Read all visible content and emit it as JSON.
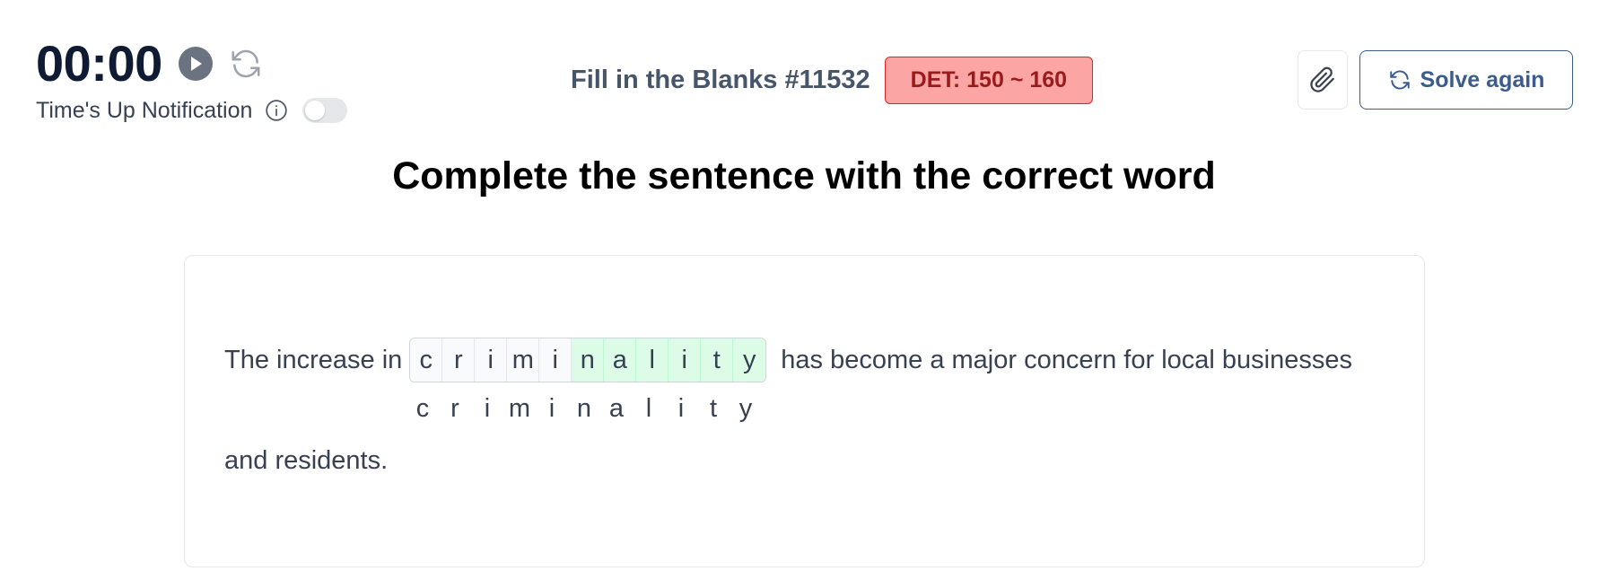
{
  "timer": {
    "value": "00:00",
    "play_icon": "play-icon",
    "reset_icon": "refresh-icon"
  },
  "notification": {
    "label": "Time's Up Notification",
    "info_icon": "info-icon",
    "enabled": false
  },
  "quiz": {
    "title": "Fill in the Blanks #11532",
    "level": "DET: 150 ~ 160"
  },
  "actions": {
    "attach_icon": "paperclip-icon",
    "solve_again_label": "Solve again",
    "solve_again_icon": "refresh-icon"
  },
  "instruction": "Complete the sentence with the correct word",
  "exercise": {
    "before": "The increase in",
    "word_letters": [
      "c",
      "r",
      "i",
      "m",
      "i",
      "n",
      "a",
      "l",
      "i",
      "t",
      "y"
    ],
    "given_count": 5,
    "after": "has become a major concern for local businesses",
    "answer_letters": [
      "c",
      "r",
      "i",
      "m",
      "i",
      "n",
      "a",
      "l",
      "i",
      "t",
      "y"
    ],
    "continuation": "and residents."
  },
  "colors": {
    "badge_bg": "#fca5a5",
    "badge_text": "#991b1b",
    "answer_cell_bg": "#dcfce7",
    "accent": "#3b5c8c"
  }
}
